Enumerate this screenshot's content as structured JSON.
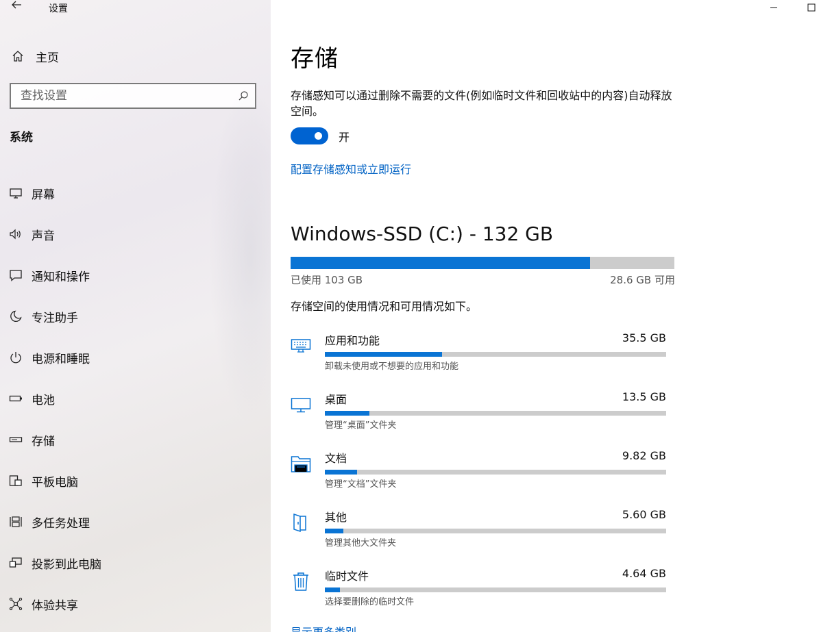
{
  "window": {
    "title": "设置",
    "back_icon": "arrow-left-icon",
    "minimize_icon": "minimize-icon",
    "maximize_icon": "maximize-icon"
  },
  "sidebar": {
    "home": {
      "label": "主页",
      "icon": "home-icon"
    },
    "search": {
      "placeholder": "查找设置",
      "icon": "search-icon"
    },
    "section_title": "系统",
    "items": [
      {
        "label": "屏幕",
        "icon": "display-icon",
        "name": "display"
      },
      {
        "label": "声音",
        "icon": "speaker-icon",
        "name": "sound"
      },
      {
        "label": "通知和操作",
        "icon": "notification-icon",
        "name": "notifications"
      },
      {
        "label": "专注助手",
        "icon": "moon-icon",
        "name": "focus-assist"
      },
      {
        "label": "电源和睡眠",
        "icon": "power-icon",
        "name": "power-sleep"
      },
      {
        "label": "电池",
        "icon": "battery-icon",
        "name": "battery"
      },
      {
        "label": "存储",
        "icon": "storage-icon",
        "name": "storage"
      },
      {
        "label": "平板电脑",
        "icon": "tablet-icon",
        "name": "tablet"
      },
      {
        "label": "多任务处理",
        "icon": "multitasking-icon",
        "name": "multitasking"
      },
      {
        "label": "投影到此电脑",
        "icon": "projecting-icon",
        "name": "projecting"
      },
      {
        "label": "体验共享",
        "icon": "shared-experiences-icon",
        "name": "shared-experiences"
      }
    ]
  },
  "main": {
    "title": "存储",
    "description": "存储感知可以通过删除不需要的文件(例如临时文件和回收站中的内容)自动释放空间。",
    "toggle": {
      "state": "开",
      "on": true
    },
    "config_link": "配置存储感知或立即运行",
    "drive": {
      "title": "Windows-SSD (C:) - 132 GB",
      "used_label": "已使用 103 GB",
      "free_label": "28.6 GB 可用",
      "used_fraction": 0.78
    },
    "usage_description": "存储空间的使用情况和可用情况如下。",
    "categories": [
      {
        "name": "应用和功能",
        "size": "35.5 GB",
        "sub": "卸载未使用或不想要的应用和功能",
        "fraction": 0.344,
        "icon": "apps-icon",
        "key": "apps"
      },
      {
        "name": "桌面",
        "size": "13.5 GB",
        "sub": "管理“桌面”文件夹",
        "fraction": 0.131,
        "icon": "desktop-icon",
        "key": "desktop"
      },
      {
        "name": "文档",
        "size": "9.82 GB",
        "sub": "管理“文档”文件夹",
        "fraction": 0.095,
        "icon": "documents-folder-icon",
        "key": "documents"
      },
      {
        "name": "其他",
        "size": "5.60 GB",
        "sub": "管理其他大文件夹",
        "fraction": 0.054,
        "icon": "other-folder-icon",
        "key": "other"
      },
      {
        "name": "临时文件",
        "size": "4.64 GB",
        "sub": "选择要删除的临时文件",
        "fraction": 0.045,
        "icon": "trash-icon",
        "key": "temp"
      }
    ],
    "more_link": "显示更多类别"
  },
  "colors": {
    "accent": "#0a74d4",
    "link": "#0062c4",
    "toggle_on": "#0063d1",
    "bar_track": "#cccccc"
  }
}
